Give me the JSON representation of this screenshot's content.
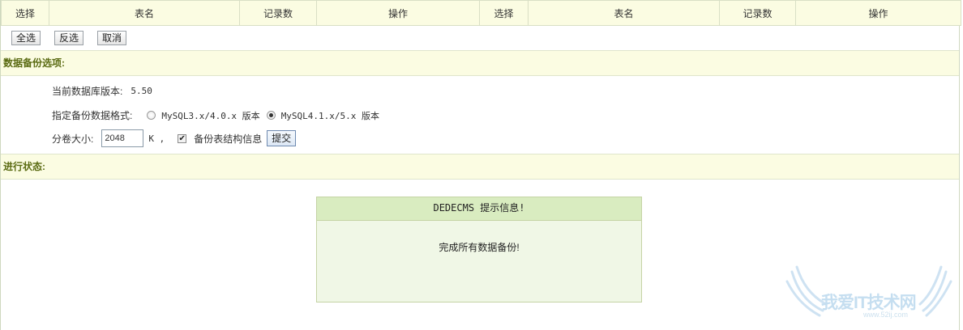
{
  "table_headers": [
    "选择",
    "表名",
    "记录数",
    "操作",
    "选择",
    "表名",
    "记录数",
    "操作"
  ],
  "buttons": {
    "select_all": "全选",
    "invert": "反选",
    "cancel": "取消"
  },
  "backup_options": {
    "title": "数据备份选项:",
    "db_version_label": "当前数据库版本:",
    "db_version_value": "5.50",
    "format_label": "指定备份数据格式:",
    "format_option_1": "MySQL3.x/4.0.x 版本",
    "format_option_2": "MySQL4.1.x/5.x 版本",
    "selected_format": "MySQL4.1.x/5.x 版本",
    "volume_size_label": "分卷大小:",
    "volume_size_value": "2048",
    "volume_size_unit": "K ,",
    "backup_structure_label": "备份表结构信息",
    "backup_structure_checked": true,
    "submit_label": "提交"
  },
  "status": {
    "title": "进行状态:",
    "message_title": "DEDECMS 提示信息!",
    "message_body": "完成所有数据备份!"
  },
  "watermark": {
    "text": "我爱IT技术网",
    "url": "www.52ij.com"
  }
}
